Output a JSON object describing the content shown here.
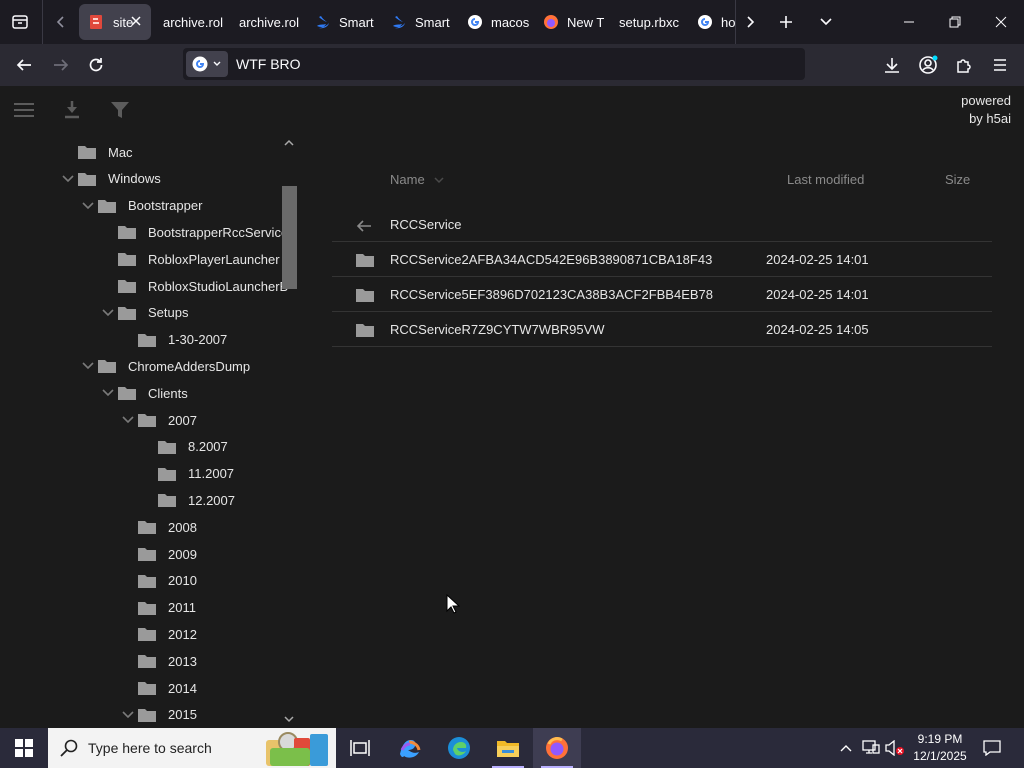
{
  "browser": {
    "tabs": [
      {
        "title": "site",
        "favicon": "h5ai-icon",
        "active": true
      },
      {
        "title": "archive.rol",
        "favicon": "none",
        "active": false
      },
      {
        "title": "archive.rol",
        "favicon": "none",
        "active": false
      },
      {
        "title": "Smart",
        "favicon": "swift-icon",
        "active": false
      },
      {
        "title": "Smart",
        "favicon": "swift-icon",
        "active": false
      },
      {
        "title": "macos",
        "favicon": "google-icon",
        "active": false
      },
      {
        "title": "New T",
        "favicon": "firefox-icon",
        "active": false
      },
      {
        "title": "setup.rbxc",
        "favicon": "none",
        "active": false
      },
      {
        "title": "hov",
        "favicon": "google-icon",
        "active": false
      }
    ],
    "url_text": "WTF BRO",
    "theme_colors": {
      "tabstrip": "#1c1b22",
      "navbar": "#2b2a33",
      "active_tab": "#42414d"
    }
  },
  "page": {
    "powered_by": [
      "powered",
      "by h5ai"
    ],
    "tree": [
      {
        "label": "Mac",
        "depth": 0,
        "chevron": "none"
      },
      {
        "label": "Windows",
        "depth": 0,
        "chevron": "down"
      },
      {
        "label": "Bootstrapper",
        "depth": 1,
        "chevron": "down"
      },
      {
        "label": "BootstrapperRccService",
        "depth": 2,
        "chevron": "none"
      },
      {
        "label": "RobloxPlayerLauncher",
        "depth": 2,
        "chevron": "none"
      },
      {
        "label": "RobloxStudioLauncherB",
        "depth": 2,
        "chevron": "none"
      },
      {
        "label": "Setups",
        "depth": 2,
        "chevron": "down"
      },
      {
        "label": "1-30-2007",
        "depth": 3,
        "chevron": "none"
      },
      {
        "label": "ChromeAddersDump",
        "depth": 1,
        "chevron": "down"
      },
      {
        "label": "Clients",
        "depth": 2,
        "chevron": "down"
      },
      {
        "label": "2007",
        "depth": 3,
        "chevron": "down"
      },
      {
        "label": "8.2007",
        "depth": 4,
        "chevron": "none"
      },
      {
        "label": "11.2007",
        "depth": 4,
        "chevron": "none"
      },
      {
        "label": "12.2007",
        "depth": 4,
        "chevron": "none"
      },
      {
        "label": "2008",
        "depth": 3,
        "chevron": "none"
      },
      {
        "label": "2009",
        "depth": 3,
        "chevron": "none"
      },
      {
        "label": "2010",
        "depth": 3,
        "chevron": "none"
      },
      {
        "label": "2011",
        "depth": 3,
        "chevron": "none"
      },
      {
        "label": "2012",
        "depth": 3,
        "chevron": "none"
      },
      {
        "label": "2013",
        "depth": 3,
        "chevron": "none"
      },
      {
        "label": "2014",
        "depth": 3,
        "chevron": "none"
      },
      {
        "label": "2015",
        "depth": 3,
        "chevron": "down"
      }
    ],
    "columns": {
      "name": "Name",
      "modified": "Last modified",
      "size": "Size"
    },
    "parent": {
      "label": "RCCService"
    },
    "files": [
      {
        "name": "RCCService2AFBA34ACD542E96B3890871CBA18F43",
        "modified": "2024-02-25 14:01",
        "size": ""
      },
      {
        "name": "RCCService5EF3896D702123CA38B3ACF2FBB4EB78",
        "modified": "2024-02-25 14:01",
        "size": ""
      },
      {
        "name": "RCCServiceR7Z9CYTW7WBR95VW",
        "modified": "2024-02-25 14:05",
        "size": ""
      }
    ]
  },
  "taskbar": {
    "search_placeholder": "Type here to search",
    "clock": {
      "time": "9:19 PM",
      "date": "12/1/2025"
    }
  }
}
